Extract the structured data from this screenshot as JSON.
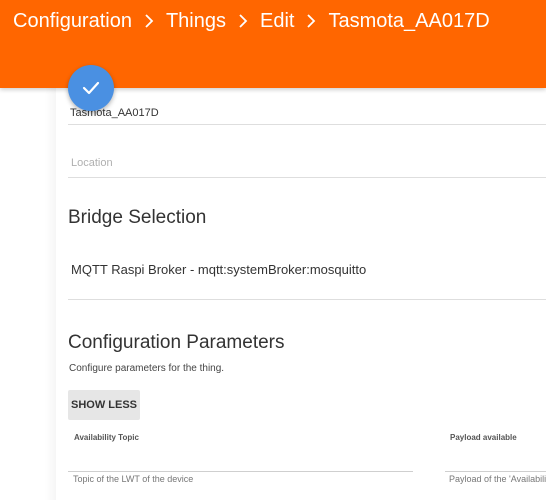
{
  "header": {
    "breadcrumb": [
      "Configuration",
      "Things",
      "Edit",
      "Tasmota_AA017D"
    ],
    "background_color": "#ff6600"
  },
  "fab": {
    "icon": "check-icon",
    "color": "#4a90e2"
  },
  "thing": {
    "name_value": "Tasmota_AA017D",
    "location_placeholder": "Location"
  },
  "bridge": {
    "title": "Bridge Selection",
    "value": "MQTT Raspi Broker - mqtt:systemBroker:mosquitto"
  },
  "config": {
    "title": "Configuration Parameters",
    "description": "Configure parameters for the thing.",
    "show_less_label": "SHOW LESS",
    "params": [
      {
        "label": "Availability Topic",
        "value": "Topic of the LWT of the device"
      },
      {
        "label": "Payload available",
        "value": "Payload of the 'Availabili"
      }
    ]
  }
}
